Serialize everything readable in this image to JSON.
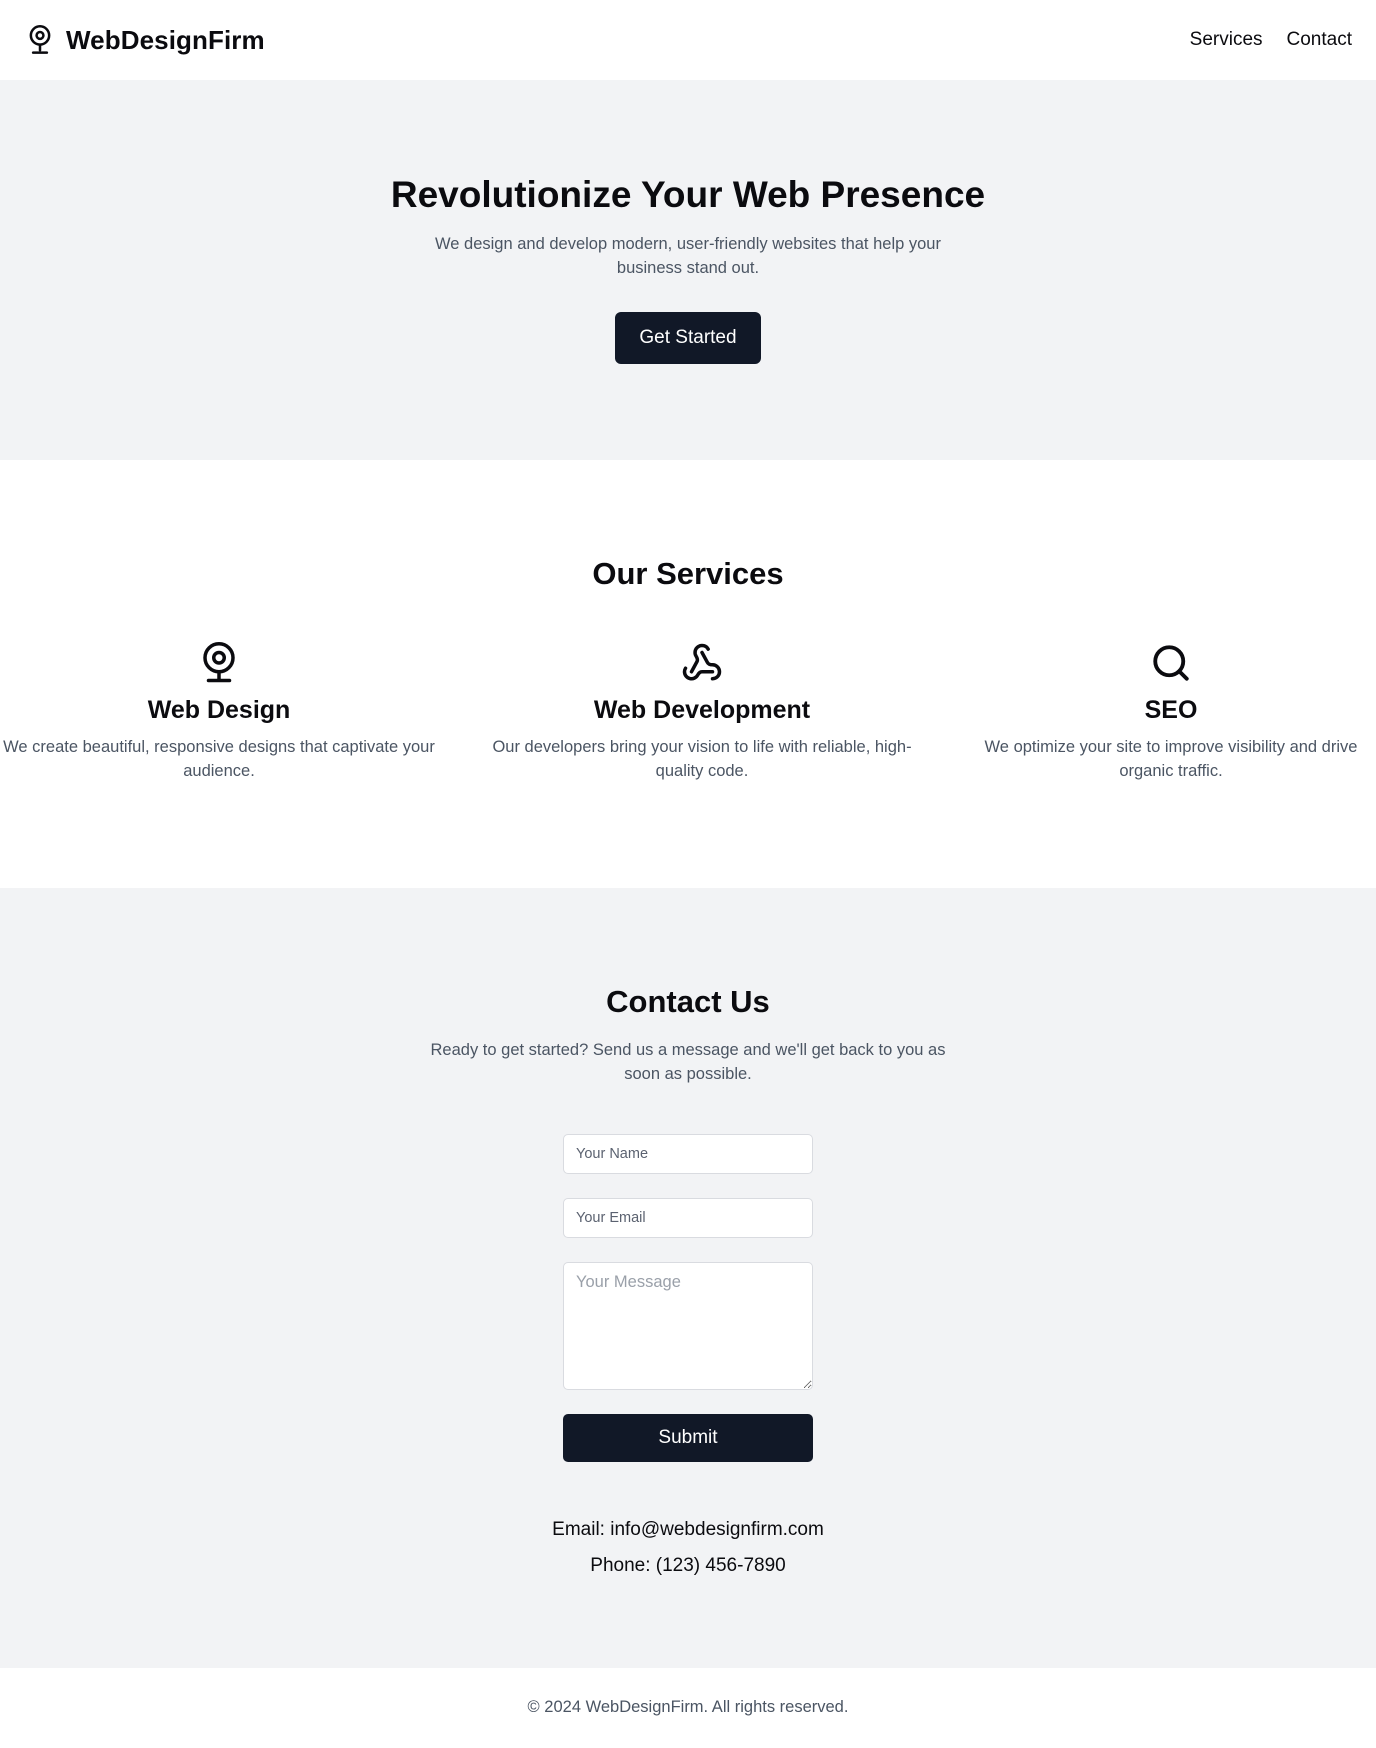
{
  "header": {
    "brand": "WebDesignFirm",
    "brand_icon": "webcam-icon",
    "nav": [
      "Services",
      "Contact"
    ]
  },
  "hero": {
    "title": "Revolutionize Your Web Presence",
    "subtitle": "We design and develop modern, user-friendly websites that help your business stand out.",
    "cta_label": "Get Started"
  },
  "services": {
    "title": "Our Services",
    "items": [
      {
        "icon": "webcam-icon",
        "title": "Web Design",
        "description": "We create beautiful, responsive designs that captivate your audience."
      },
      {
        "icon": "webhook-icon",
        "title": "Web Development",
        "description": "Our developers bring your vision to life with reliable, high-quality code."
      },
      {
        "icon": "search-icon",
        "title": "SEO",
        "description": "We optimize your site to improve visibility and drive organic traffic."
      }
    ]
  },
  "contact": {
    "title": "Contact Us",
    "lead": "Ready to get started? Send us a message and we'll get back to you as soon as possible.",
    "form": {
      "name_placeholder": "Your Name",
      "email_placeholder": "Your Email",
      "message_placeholder": "Your Message",
      "submit_label": "Submit"
    },
    "email_line": "Email: info@webdesignfirm.com",
    "phone_line": "Phone: (123) 456-7890"
  },
  "footer": {
    "copyright": "© 2024 WebDesignFirm. All rights reserved."
  },
  "colors": {
    "primary_button": "#111827",
    "section_alt_bg": "#f2f3f5",
    "muted_text": "#4b5563"
  }
}
